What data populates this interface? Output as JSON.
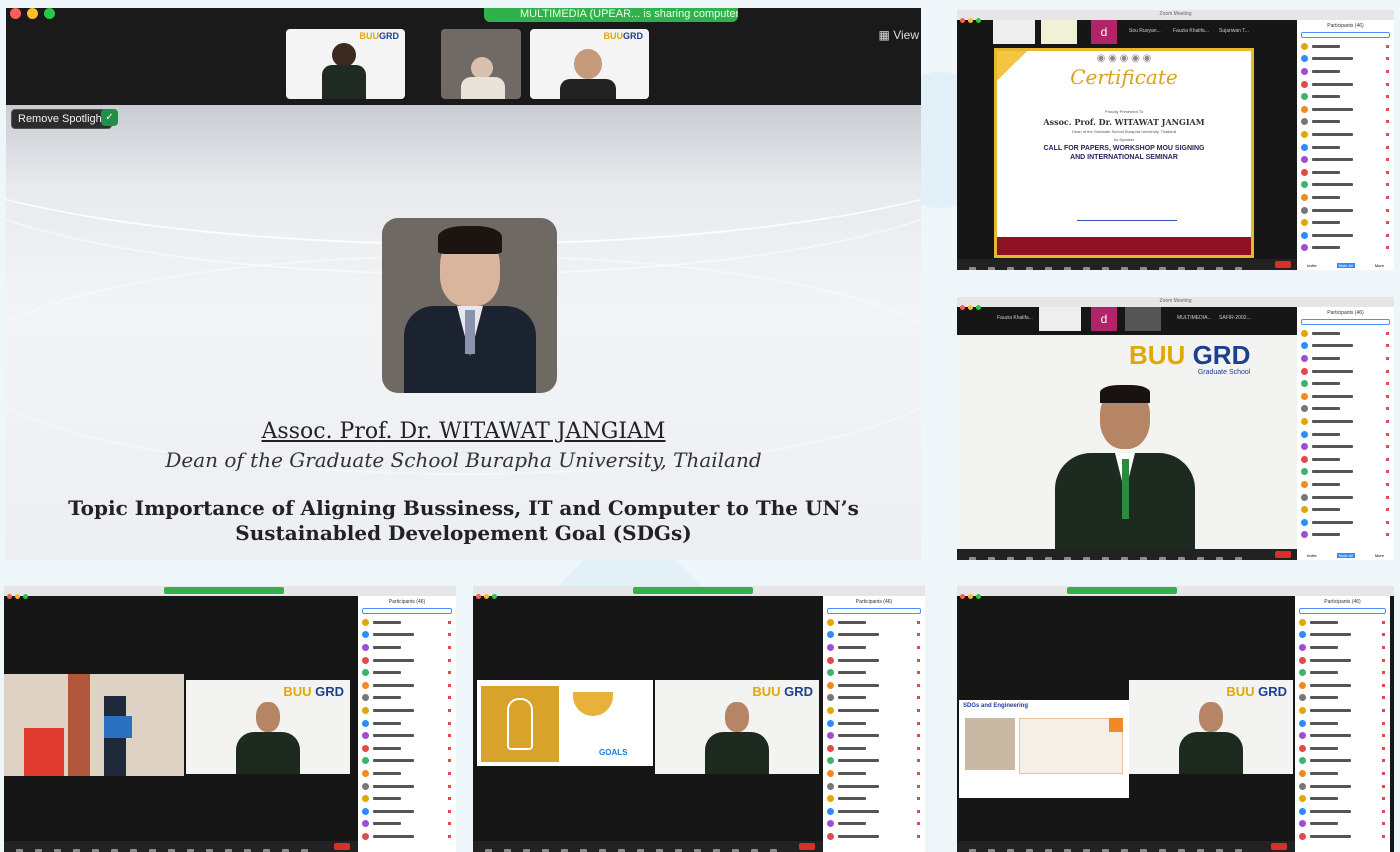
{
  "main_window": {
    "share_banner": "MULTIMEDIA (UPEAR... is sharing computer sound",
    "view_button": "View",
    "strip": {
      "logo_buu": "BUU",
      "logo_grd": "GRD"
    },
    "remove_spotlight_label": "Remove Spotlight",
    "slide": {
      "speaker_name": "Assoc. Prof. Dr. WITAWAT JANGIAM",
      "speaker_role": "Dean of the Graduate School Burapha University, Thailand",
      "topic": "Topic Importance of Aligning Bussiness, IT and Computer to The UN’s Sustainabled Developement Goal (SDGs)"
    }
  },
  "certificate_window": {
    "title": "Zoom Meeting",
    "panel_title": "Participants (46)",
    "search_placeholder": "Q Search",
    "tabs": [
      "Sou Ruoyan...",
      "Fauzia Khalifa...",
      "Sujariwan T..."
    ],
    "tile_letter": "d",
    "certificate": {
      "heading": "Certificate",
      "presented_to": "Proudly Presented To",
      "recipient": "Assoc. Prof. Dr. WITAWAT JANGIAM",
      "recipient_role": "Dean of the Graduate School Burapha University, Thailand",
      "as_speaker": "As Speaker",
      "event_line1": "CALL FOR PAPERS, WORKSHOP MOU SIGNING",
      "event_line2": "AND INTERNATIONAL SEMINAR"
    },
    "footer_buttons": [
      "Invite",
      "Mute All",
      "More"
    ]
  },
  "gallery_window": {
    "title": "Zoom Meeting",
    "panel_title": "Participants (46)",
    "tabs": [
      "Fauzia Khalifa...",
      "MULTIMEDIA...",
      "SAFIR-2002..."
    ],
    "tile_letter": "d",
    "logo_buu": "BUU",
    "logo_grd": "GRD",
    "logo_sub": "Graduate School",
    "footer_buttons": [
      "Invite",
      "Mute All",
      "More"
    ]
  },
  "bottom_windows": [
    {
      "panel_title": "Participants (46)",
      "logo_buu": "BUU",
      "logo_grd": "GRD"
    },
    {
      "panel_title": "Participants (46)",
      "logo_buu": "BUU",
      "logo_grd": "GRD",
      "sdg_goals": "GOALS"
    },
    {
      "panel_title": "Participants (46)",
      "logo_buu": "BUU",
      "logo_grd": "GRD",
      "slide_heading": "SDGs and Engineering"
    }
  ],
  "colors": {
    "zoom_green": "#2fb24c",
    "leave_red": "#d93025",
    "buu_gold": "#e0a800",
    "grd_blue": "#1d3f8f"
  }
}
